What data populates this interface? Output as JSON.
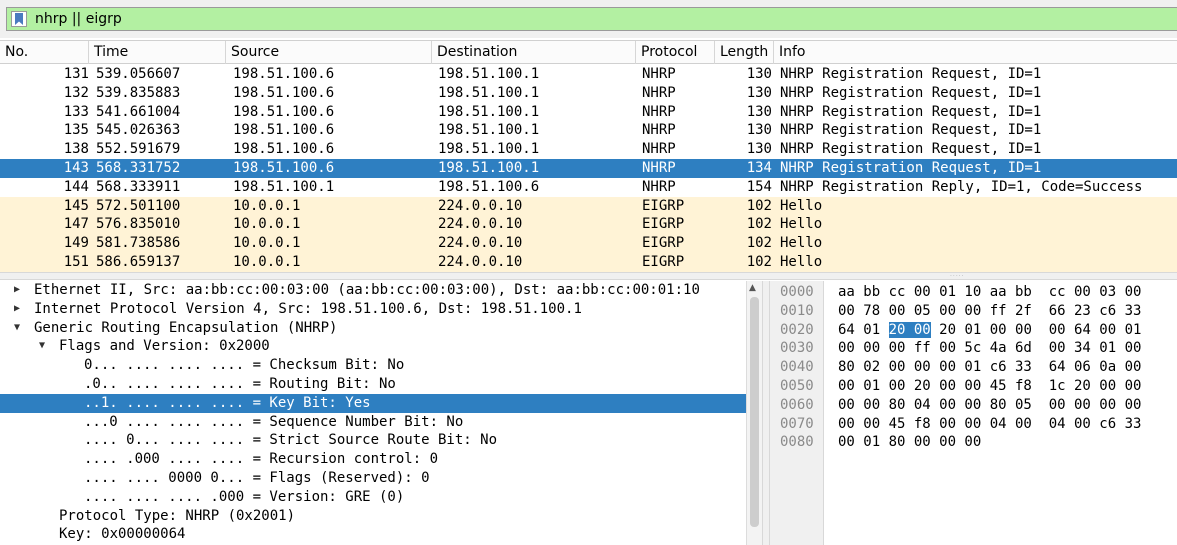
{
  "filter": {
    "text": "nhrp || eigrp",
    "bookmark_icon": "bookmark-icon"
  },
  "columns": [
    "No.",
    "Time",
    "Source",
    "Destination",
    "Protocol",
    "Length",
    "Info"
  ],
  "packets": [
    {
      "no": "131",
      "time": "539.056607",
      "src": "198.51.100.6",
      "dst": "198.51.100.1",
      "proto": "NHRP",
      "len": "130",
      "info": "NHRP Registration Request, ID=1"
    },
    {
      "no": "132",
      "time": "539.835883",
      "src": "198.51.100.6",
      "dst": "198.51.100.1",
      "proto": "NHRP",
      "len": "130",
      "info": "NHRP Registration Request, ID=1"
    },
    {
      "no": "133",
      "time": "541.661004",
      "src": "198.51.100.6",
      "dst": "198.51.100.1",
      "proto": "NHRP",
      "len": "130",
      "info": "NHRP Registration Request, ID=1"
    },
    {
      "no": "135",
      "time": "545.026363",
      "src": "198.51.100.6",
      "dst": "198.51.100.1",
      "proto": "NHRP",
      "len": "130",
      "info": "NHRP Registration Request, ID=1"
    },
    {
      "no": "138",
      "time": "552.591679",
      "src": "198.51.100.6",
      "dst": "198.51.100.1",
      "proto": "NHRP",
      "len": "130",
      "info": "NHRP Registration Request, ID=1"
    },
    {
      "no": "143",
      "time": "568.331752",
      "src": "198.51.100.6",
      "dst": "198.51.100.1",
      "proto": "NHRP",
      "len": "134",
      "info": "NHRP Registration Request, ID=1"
    },
    {
      "no": "144",
      "time": "568.333911",
      "src": "198.51.100.1",
      "dst": "198.51.100.6",
      "proto": "NHRP",
      "len": "154",
      "info": "NHRP Registration Reply, ID=1, Code=Success"
    },
    {
      "no": "145",
      "time": "572.501100",
      "src": "10.0.0.1",
      "dst": "224.0.0.10",
      "proto": "EIGRP",
      "len": "102",
      "info": "Hello"
    },
    {
      "no": "147",
      "time": "576.835010",
      "src": "10.0.0.1",
      "dst": "224.0.0.10",
      "proto": "EIGRP",
      "len": "102",
      "info": "Hello"
    },
    {
      "no": "149",
      "time": "581.738586",
      "src": "10.0.0.1",
      "dst": "224.0.0.10",
      "proto": "EIGRP",
      "len": "102",
      "info": "Hello"
    },
    {
      "no": "151",
      "time": "586.659137",
      "src": "10.0.0.1",
      "dst": "224.0.0.10",
      "proto": "EIGRP",
      "len": "102",
      "info": "Hello"
    }
  ],
  "selected_packet": "143",
  "details": [
    {
      "text": "Ethernet II, Src: aa:bb:cc:00:03:00 (aa:bb:cc:00:03:00), Dst: aa:bb:cc:00:01:10",
      "state": "collapsed"
    },
    {
      "text": "Internet Protocol Version 4, Src: 198.51.100.6, Dst: 198.51.100.1",
      "state": "collapsed"
    },
    {
      "text": "Generic Routing Encapsulation (NHRP)",
      "state": "expanded"
    },
    {
      "text": "Flags and Version: 0x2000",
      "state": "expanded"
    },
    {
      "text": "0... .... .... .... = Checksum Bit: No",
      "state": "leaf"
    },
    {
      "text": ".0.. .... .... .... = Routing Bit: No",
      "state": "leaf"
    },
    {
      "text": "..1. .... .... .... = Key Bit: Yes",
      "state": "leaf"
    },
    {
      "text": "...0 .... .... .... = Sequence Number Bit: No",
      "state": "leaf"
    },
    {
      "text": ".... 0... .... .... = Strict Source Route Bit: No",
      "state": "leaf"
    },
    {
      "text": ".... .000 .... .... = Recursion control: 0",
      "state": "leaf"
    },
    {
      "text": ".... .... 0000 0... = Flags (Reserved): 0",
      "state": "leaf"
    },
    {
      "text": ".... .... .... .000 = Version: GRE (0)",
      "state": "leaf"
    },
    {
      "text": "Protocol Type: NHRP (0x2001)",
      "state": "leaf"
    },
    {
      "text": "Key: 0x00000064",
      "state": "leaf"
    }
  ],
  "selected_detail": "..1. .... .... .... = Key Bit: Yes",
  "hex": [
    {
      "offset": "0000",
      "bytes": "aa bb cc 00 01 10 aa bb  cc 00 03 00"
    },
    {
      "offset": "0010",
      "bytes": "00 78 00 05 00 00 ff 2f  66 23 c6 33"
    },
    {
      "offset": "0020",
      "pre": "64 01 ",
      "hl": "20 00",
      "post": " 20 01 00 00  00 64 00 01"
    },
    {
      "offset": "0030",
      "bytes": "00 00 00 ff 00 5c 4a 6d  00 34 01 00"
    },
    {
      "offset": "0040",
      "bytes": "80 02 00 00 00 01 c6 33  64 06 0a 00"
    },
    {
      "offset": "0050",
      "bytes": "00 01 00 20 00 00 45 f8  1c 20 00 00"
    },
    {
      "offset": "0060",
      "bytes": "00 00 80 04 00 00 80 05  00 00 00 00"
    },
    {
      "offset": "0070",
      "bytes": "00 00 45 f8 00 00 04 00  04 00 c6 33"
    },
    {
      "offset": "0080",
      "bytes": "00 01 80 00 00 00"
    }
  ],
  "colors": {
    "filter_valid": "#b3f0a2",
    "selection": "#2e7fc1",
    "eigrp_row": "#fff3d6"
  }
}
